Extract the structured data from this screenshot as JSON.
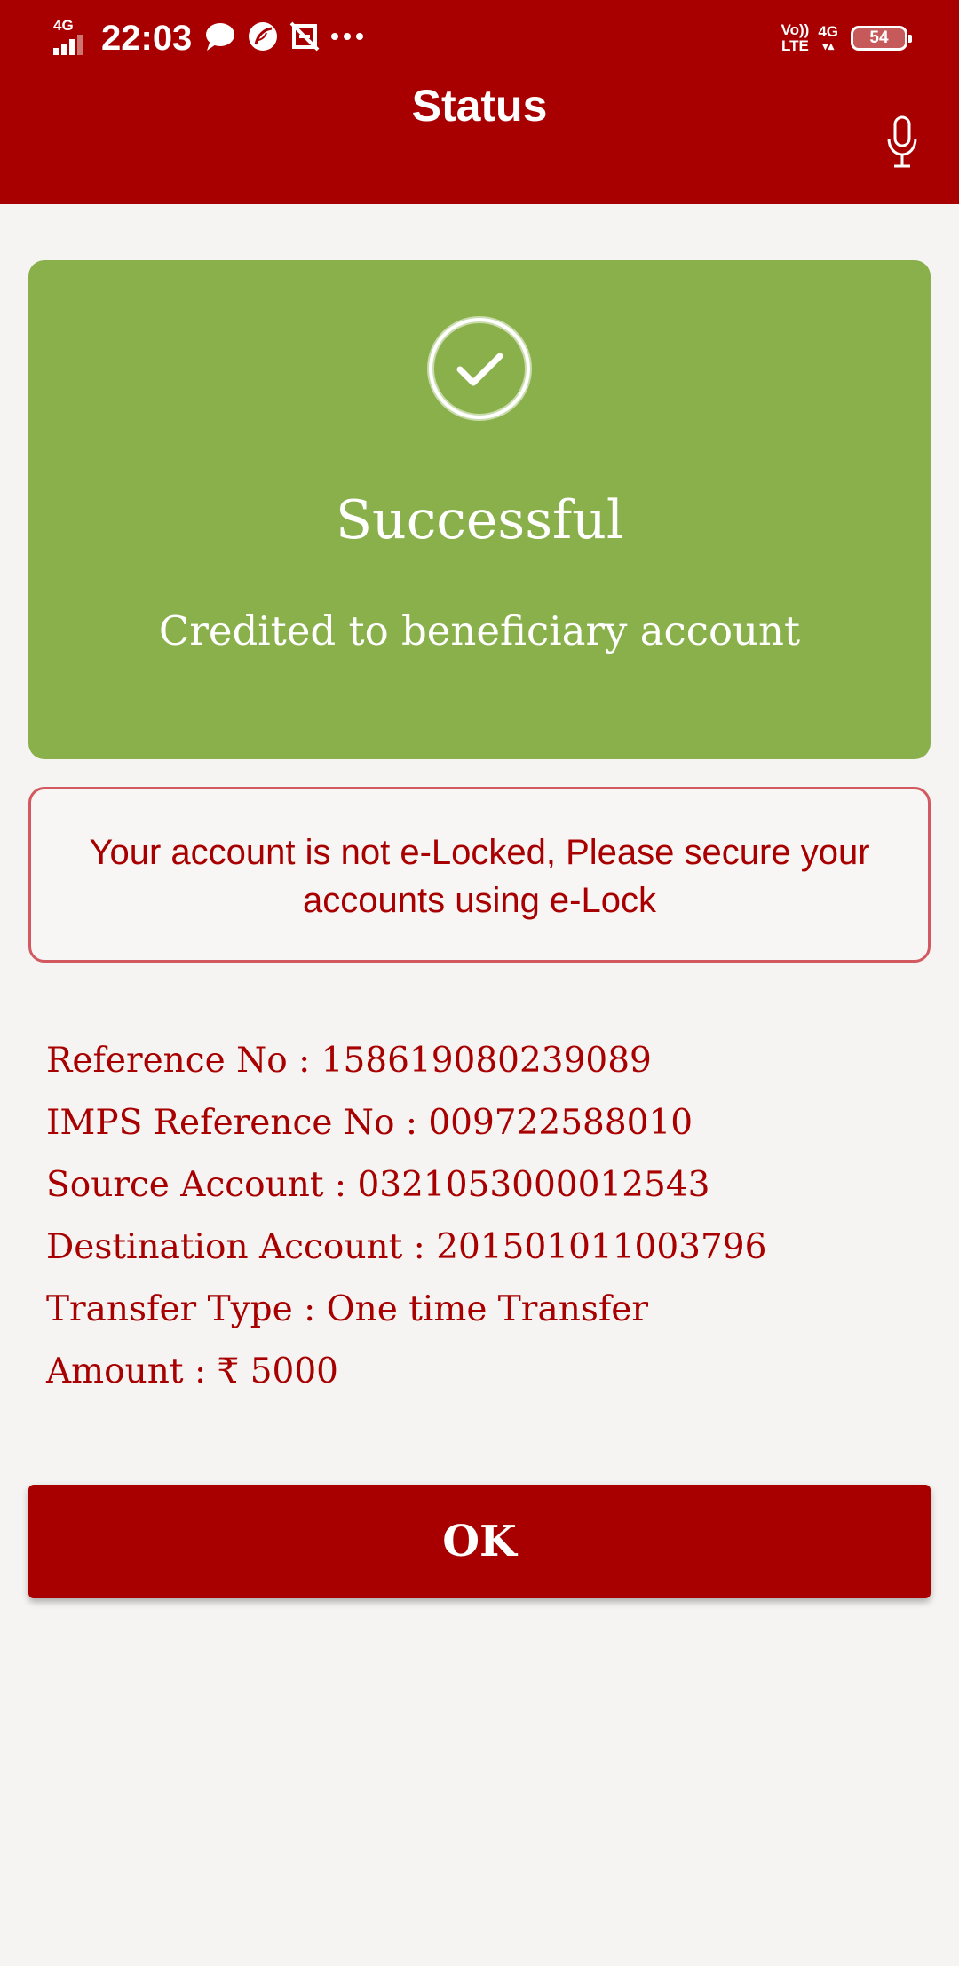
{
  "status_bar": {
    "network": "4G",
    "time": "22:03",
    "volte_top": "Vo))",
    "volte_bottom": "LTE",
    "network_right": "4G",
    "battery": "54",
    "icons": [
      "message-icon",
      "leaf-app-icon",
      "screenshot-off-icon",
      "more-icon"
    ]
  },
  "app_bar": {
    "title": "Status",
    "mic_icon": "microphone-icon"
  },
  "success_card": {
    "icon": "check-circle-icon",
    "title": "Successful",
    "subtitle": "Credited to beneficiary account",
    "color": "#89b04a"
  },
  "elock_notice": {
    "text": "Your account is not e-Locked, Please secure your accounts using e-Lock"
  },
  "details": [
    {
      "label": "Reference No",
      "value": "158619080239089"
    },
    {
      "label": "IMPS Reference No",
      "value": "009722588010"
    },
    {
      "label": "Source Account",
      "value": "0321053000012543"
    },
    {
      "label": "Destination Account",
      "value": "201501011003796"
    },
    {
      "label": "Transfer Type",
      "value": "One time Transfer"
    },
    {
      "label": "Amount",
      "value": "₹ 5000"
    }
  ],
  "ok_button": {
    "label": "OK"
  },
  "colors": {
    "brand": "#a80000",
    "success": "#89b04a",
    "notice_border": "#d25960",
    "background": "#f5f4f2"
  }
}
